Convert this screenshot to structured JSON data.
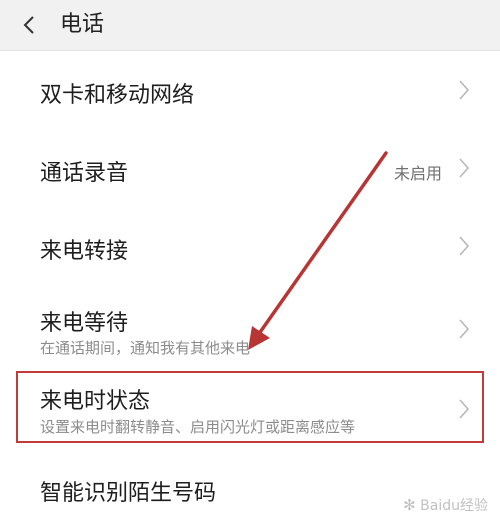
{
  "header": {
    "title": "电话"
  },
  "rows": [
    {
      "label": "双卡和移动网络"
    },
    {
      "label": "通话录音",
      "value": "未启用"
    },
    {
      "label": "来电转接"
    },
    {
      "label": "来电等待",
      "description": "在通话期间，通知我有其他来电"
    },
    {
      "label": "来电时状态",
      "description": "设置来电时翻转静音、启用闪光灯或距离感应等"
    },
    {
      "label": "智能识别陌生号码"
    }
  ],
  "watermark": {
    "text": "Baidu经验"
  },
  "colors": {
    "header_bg": "#f1f1f1",
    "annotation": "#c23a3a",
    "text": "#1e1e1e",
    "secondary_text": "#8c8c8c"
  },
  "icons": {
    "back": "chevron-left-icon",
    "row_arrow": "chevron-right-icon"
  }
}
